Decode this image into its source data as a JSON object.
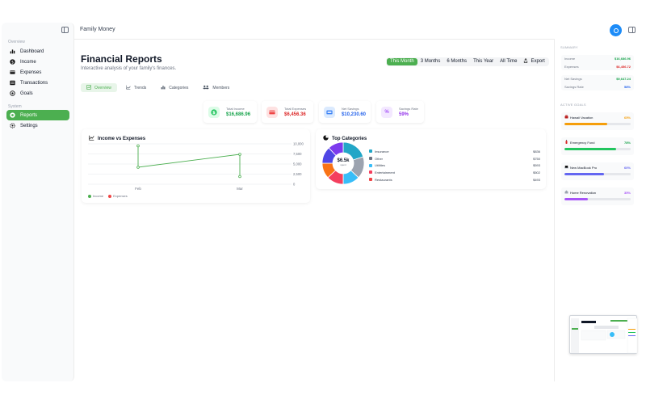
{
  "window": {
    "title": "Family Money"
  },
  "sidebar": {
    "sections": [
      {
        "label": "Overview",
        "items": [
          {
            "label": "Dashboard",
            "icon": "bar-chart-icon"
          },
          {
            "label": "Income",
            "icon": "income-icon"
          },
          {
            "label": "Expenses",
            "icon": "card-icon"
          },
          {
            "label": "Transactions",
            "icon": "list-icon"
          },
          {
            "label": "Goals",
            "icon": "target-icon"
          }
        ]
      },
      {
        "label": "System",
        "items": [
          {
            "label": "Reports",
            "icon": "report-icon",
            "active": true
          },
          {
            "label": "Settings",
            "icon": "gear-icon"
          }
        ]
      }
    ]
  },
  "header": {
    "title": "Financial Reports",
    "subtitle": "Interactive analysis of your family's finances.",
    "ranges": [
      "This Month",
      "3 Months",
      "6 Months",
      "This Year",
      "All Time"
    ],
    "active_range": "This Month",
    "export_label": "Export"
  },
  "view_tabs": [
    "Overview",
    "Trends",
    "Categories",
    "Members"
  ],
  "stats": [
    {
      "label": "Total Income",
      "value": "$16,686.96",
      "color": "#22c55e"
    },
    {
      "label": "Total Expenses",
      "value": "$6,456.36",
      "color": "#ef4444"
    },
    {
      "label": "Net Savings",
      "value": "$10,230.60",
      "color": "#3b82f6"
    },
    {
      "label": "Savings Rate",
      "value": "59%",
      "color": "#a855f7"
    }
  ],
  "income_chart": {
    "title": "Income vs Expenses",
    "legend": [
      "Income",
      "Expenses"
    ],
    "chart_data": {
      "type": "line",
      "categories": [
        "Feb",
        "Mar"
      ],
      "series": [
        {
          "name": "Income",
          "values": [
            9500,
            7400
          ]
        },
        {
          "name": "Expenses",
          "values": [
            4200,
            1900
          ]
        }
      ],
      "ylim": [
        0,
        10000
      ],
      "yticks": [
        "10,000",
        "7,500",
        "5,000",
        "2,500",
        "0"
      ],
      "colors": {
        "line": "#4caf50"
      }
    }
  },
  "categories_chart": {
    "title": "Top Categories",
    "center_value": "$6.5k",
    "center_label": "spent",
    "chart_data": {
      "type": "pie",
      "labels": [
        "Insurance",
        "Other",
        "Utilities",
        "Entertainment",
        "Restaurants"
      ],
      "values": [
        836,
        750,
        593,
        502,
        493
      ],
      "display_values": [
        "$836",
        "$750",
        "$593",
        "$502",
        "$493"
      ],
      "colors": [
        "#22a6c7",
        "#6b7280",
        "#38bdf8",
        "#f43f5e",
        "#ef4444"
      ],
      "ring_colors": [
        "#22a6c7",
        "#9ca3af",
        "#38bdf8",
        "#f43f5e",
        "#f97316",
        "#4f46e5",
        "#7c3aed"
      ]
    }
  },
  "summary": {
    "heading": "SUMMARY",
    "rows1": [
      {
        "label": "Income",
        "value": "$16,686.96",
        "color": "#16a34a"
      },
      {
        "label": "Expenses",
        "value": "$6,456.72",
        "color": "#dc2626"
      }
    ],
    "rows2": [
      {
        "label": "Net Savings",
        "value": "$9,647.24",
        "color": "#16a34a"
      },
      {
        "label": "Savings Rate",
        "value": "58%",
        "color": "#2563eb"
      }
    ]
  },
  "goals": {
    "heading": "ACTIVE GOALS",
    "items": [
      {
        "name": "Hawaii Vacation",
        "pct_label": "65%",
        "pct": 0.65,
        "color": "#f59e0b"
      },
      {
        "name": "Emergency Fund",
        "pct_label": "78%",
        "pct": 0.78,
        "color": "#22c55e"
      },
      {
        "name": "New MacBook Pro",
        "pct_label": "60%",
        "pct": 0.6,
        "color": "#6366f1"
      },
      {
        "name": "Home Renovation",
        "pct_label": "35%",
        "pct": 0.35,
        "color": "#a855f7"
      }
    ]
  }
}
